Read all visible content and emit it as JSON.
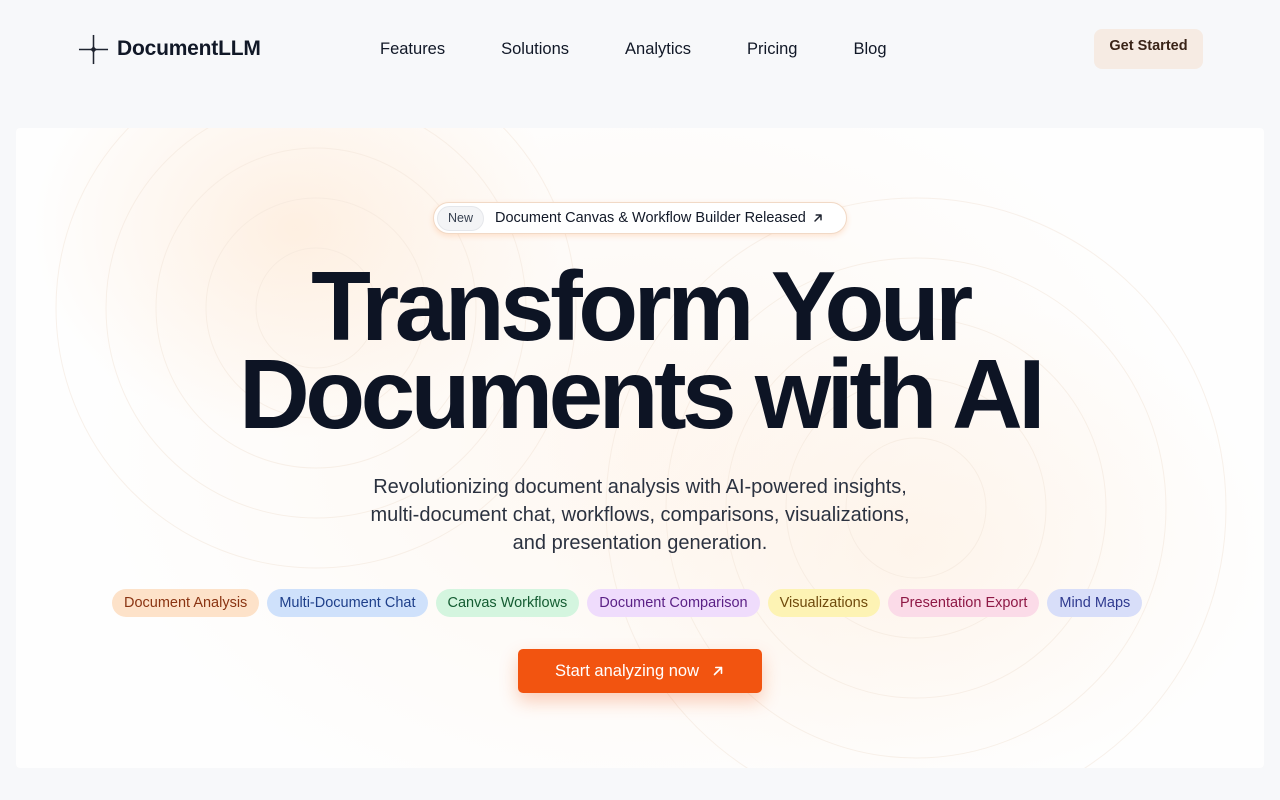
{
  "header": {
    "brand": "DocumentLLM",
    "brand_icon": "sparkle-icon",
    "nav": [
      {
        "label": "Features"
      },
      {
        "label": "Solutions"
      },
      {
        "label": "Analytics"
      },
      {
        "label": "Pricing"
      },
      {
        "label": "Blog"
      }
    ],
    "cta_label": "Get Started"
  },
  "hero": {
    "announcement": {
      "badge": "New",
      "text": "Document Canvas & Workflow Builder Released",
      "icon": "arrow-up-right-icon"
    },
    "headline_line1": "Transform Your",
    "headline_line2": "Documents with AI",
    "subtitle": "Revolutionizing document analysis with AI-powered insights, multi-document chat, workflows, comparisons, visualizations, and presentation generation.",
    "tags": [
      {
        "label": "Document Analysis",
        "bg": "#fde2c9",
        "fg": "#8a3412"
      },
      {
        "label": "Multi-Document Chat",
        "bg": "#cfe1fb",
        "fg": "#1e3f8a"
      },
      {
        "label": "Canvas Workflows",
        "bg": "#d4f5df",
        "fg": "#145c32"
      },
      {
        "label": "Document Comparison",
        "bg": "#efdcfc",
        "fg": "#5b2186"
      },
      {
        "label": "Visualizations",
        "bg": "#fdf3b4",
        "fg": "#6f4a0c"
      },
      {
        "label": "Presentation Export",
        "bg": "#fbdbe8",
        "fg": "#8e1845"
      },
      {
        "label": "Mind Maps",
        "bg": "#d8def9",
        "fg": "#2f3a8f"
      }
    ],
    "cta_label": "Start analyzing now",
    "cta_icon": "arrow-up-right-icon"
  },
  "colors": {
    "accent": "#f25410",
    "page_bg": "#f7f8fa",
    "text": "#0d1424"
  }
}
